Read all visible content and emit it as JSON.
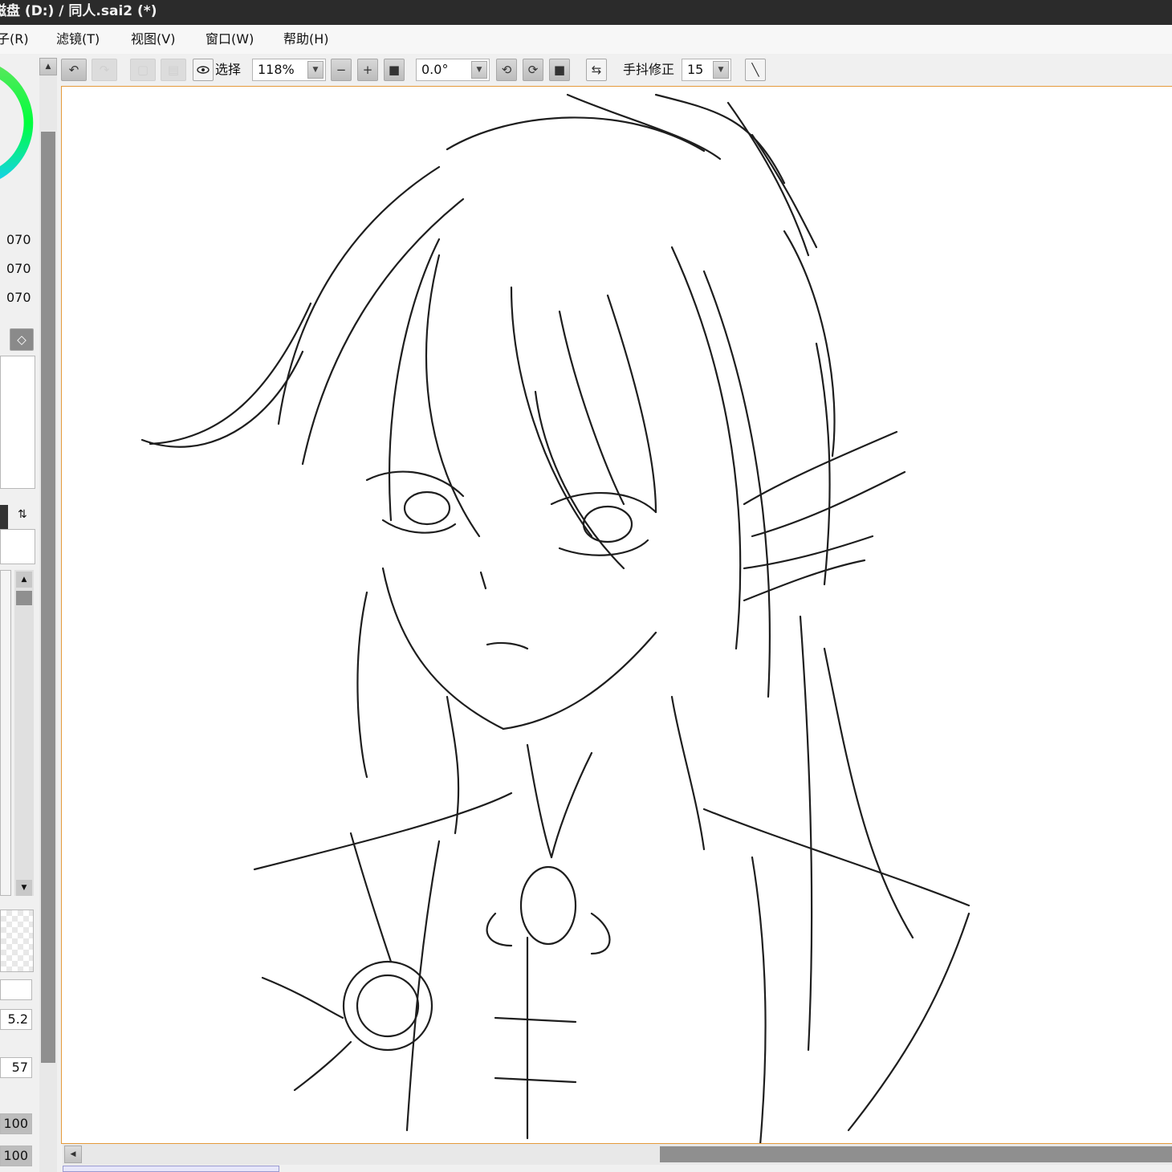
{
  "window": {
    "title": "磁盘 (D:) / 同人.sai2 (*)"
  },
  "menu": [
    {
      "id": "r",
      "label": "子(R)"
    },
    {
      "id": "t",
      "label": "滤镜(T)"
    },
    {
      "id": "v",
      "label": "视图(V)"
    },
    {
      "id": "w",
      "label": "窗口(W)"
    },
    {
      "id": "h",
      "label": "帮助(H)"
    }
  ],
  "toolbar": {
    "select_label": "选择",
    "zoom_value": "118%",
    "rotation_value": "0.0°",
    "stabilizer_label": "手抖修正",
    "stabilizer_value": "15"
  },
  "left_panel": {
    "color_values": [
      "070",
      "070",
      "070"
    ],
    "brush_size": "5.2",
    "density": "57",
    "opacity_1": "100",
    "opacity_2": "100"
  },
  "colors": {
    "accent_border": "#e59a3a",
    "titlebar_bg": "#2b2b2b"
  },
  "canvas": {
    "content": "pencil sketch of an anime character with long hair"
  }
}
